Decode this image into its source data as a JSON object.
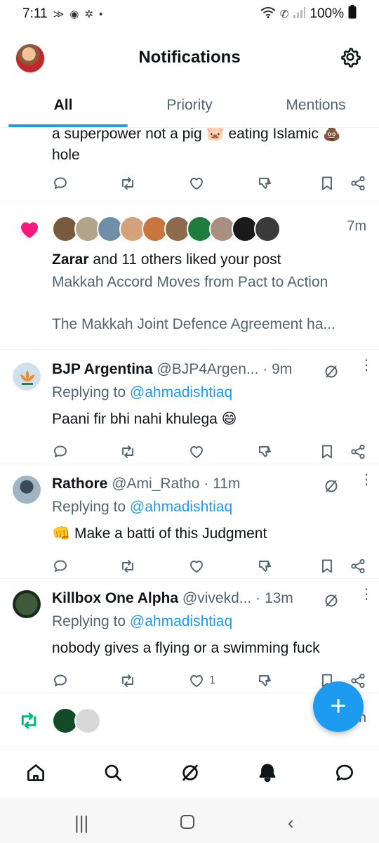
{
  "status": {
    "time": "7:11",
    "battery": "100%",
    "icons": [
      "hbl-icon",
      "messenger-icon",
      "settings-dot-icon",
      "wifi-icon",
      "call-icon",
      "signal-icon",
      "battery-icon"
    ]
  },
  "header": {
    "title": "Notifications"
  },
  "tabs": [
    {
      "label": "All",
      "active": true
    },
    {
      "label": "Priority",
      "active": false
    },
    {
      "label": "Mentions",
      "active": false
    }
  ],
  "feed": {
    "partial_post": {
      "line1": "a superpower not a pig 🐷 eating Islamic 💩",
      "line2": "hole"
    },
    "like_notification": {
      "time": "7m",
      "actor": "Zarar",
      "summary": " and 11 others liked your post",
      "post_title": "Makkah Accord Moves from Pact to Action",
      "post_excerpt": "The Makkah Joint Defence Agreement ha..."
    },
    "replies": [
      {
        "name": "BJP Argentina",
        "handle": "@BJP4Argen...",
        "time": "· 9m",
        "replying_prefix": "Replying to ",
        "replying_to": "@ahmadishtiaq",
        "text": "Paani fir bhi nahi khulega 😄",
        "like_count": ""
      },
      {
        "name": "Rathore",
        "handle": "@Ami_Ratho",
        "time": "· 11m",
        "replying_prefix": "Replying to ",
        "replying_to": "@ahmadishtiaq",
        "text": "👊 Make a batti of this Judgment",
        "like_count": ""
      },
      {
        "name": "Killbox One Alpha",
        "handle": "@vivekd...",
        "time": "· 13m",
        "replying_prefix": "Replying to ",
        "replying_to": "@ahmadishtiaq",
        "text": "nobody gives a flying or a swimming fuck",
        "like_count": "1"
      }
    ],
    "partial_repost_tail": "n"
  },
  "colors": {
    "accent": "#1d9bf0",
    "like": "#f91880",
    "repost": "#00ba7c",
    "text": "#0f1419",
    "muted": "#536471"
  }
}
